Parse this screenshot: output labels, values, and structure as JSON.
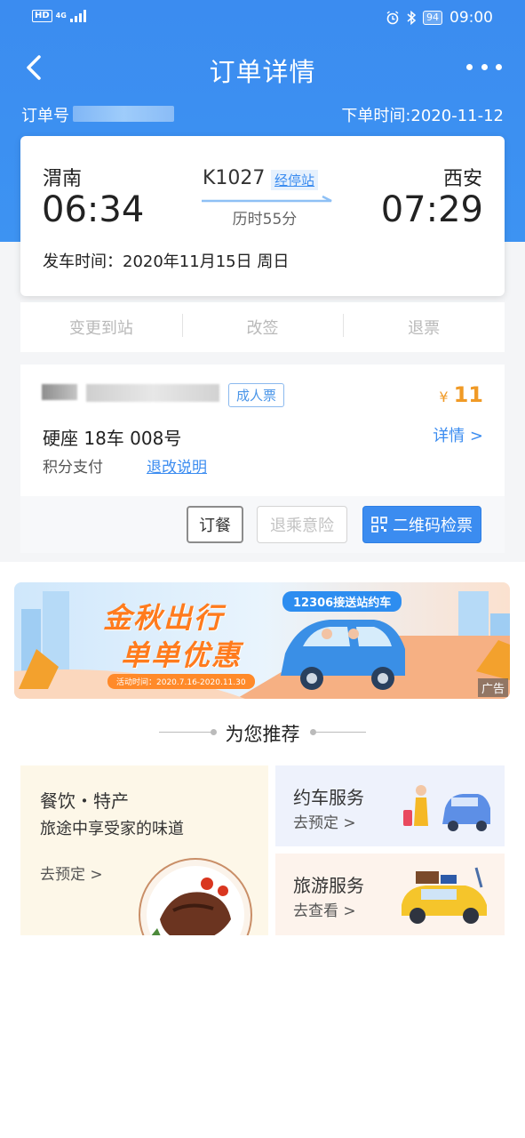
{
  "status_bar": {
    "hd": "HD",
    "network": "4G",
    "battery": "94",
    "time": "09:00"
  },
  "header": {
    "title": "订单详情",
    "order_label": "订单号",
    "order_time": "下单时间:2020-11-12"
  },
  "trip": {
    "from_city": "渭南",
    "from_time": "06:34",
    "to_city": "西安",
    "to_time": "07:29",
    "train_no": "K1027",
    "via_label": "经停站",
    "duration": "历时55分",
    "depart_date": "发车时间：2020年11月15日 周日"
  },
  "actions": [
    "变更到站",
    "改签",
    "退票"
  ],
  "passenger": {
    "ticket_type": "成人票",
    "currency": "¥",
    "price": "11",
    "seat": "硬座 18车 008号",
    "detail_link": "详情 >",
    "payment": "积分支付",
    "refund_link": "退改说明"
  },
  "buttons": {
    "meal": "订餐",
    "insurance": "退乘意险",
    "qr": "二维码检票"
  },
  "banner": {
    "title_line1": "金秋出行",
    "title_line2": "单单优惠",
    "tag": "12306接送站约车",
    "date": "活动时间：2020.7.16-2020.11.30",
    "ad": "广告"
  },
  "recommend": {
    "heading": "为您推荐",
    "food": {
      "title": "餐饮・特产",
      "subtitle": "旅途中享受家的味道",
      "link": "去预定 >"
    },
    "car": {
      "title": "约车服务",
      "link": "去预定 >"
    },
    "tour": {
      "title": "旅游服务",
      "link": "去查看 >"
    }
  },
  "colors": {
    "primary": "#3b8cf0",
    "price": "#f09a26",
    "banner_orange": "#ff7b1d"
  }
}
